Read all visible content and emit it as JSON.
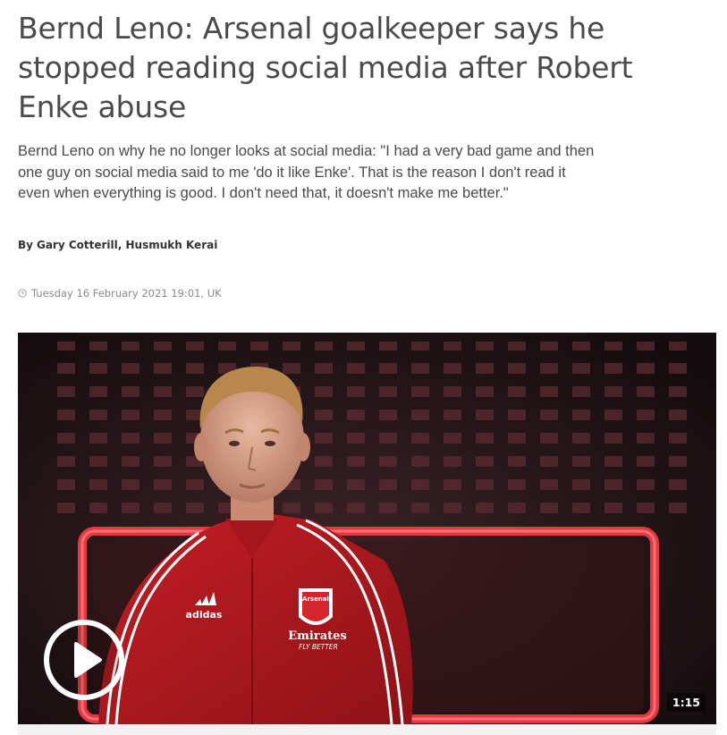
{
  "article": {
    "headline": "Bernd Leno: Arsenal goalkeeper says he stopped reading social media after Robert Enke abuse",
    "standfirst": "Bernd Leno on why he no longer looks at social media: \"I had a very bad game and then one guy on social media said to me 'do it like Enke'.  That is the reason I don't read it even when everything is good. I don't need that, it doesn't make me better.\"",
    "byline_prefix": "By",
    "authors": "Gary Cotterill, Husmukh Kerai",
    "timestamp": "Tuesday 16 February 2021 19:01, UK",
    "timestamp_icon": "clock-icon"
  },
  "video": {
    "duration": "1:15",
    "play_icon": "play-icon",
    "shirt_sponsor": "Emirates",
    "shirt_slogan": "FLY BETTER",
    "shirt_brand": "adidas",
    "crest_text": "Arsenal",
    "accent_color": "#e2333b"
  }
}
